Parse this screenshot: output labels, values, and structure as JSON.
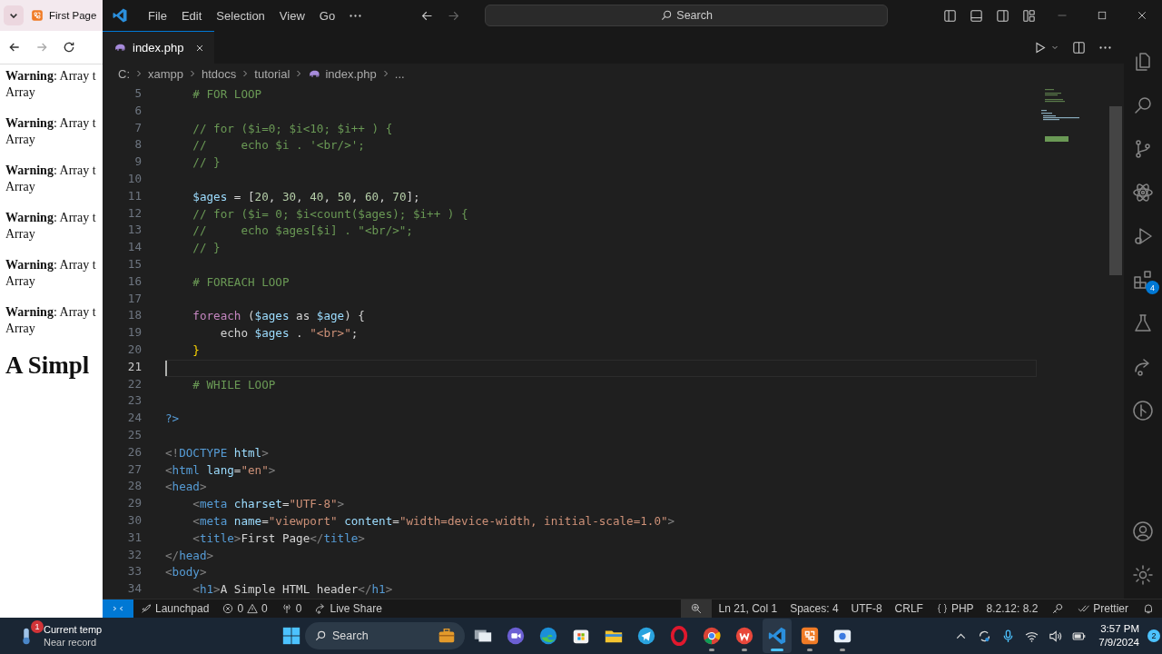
{
  "browser": {
    "tab": {
      "title": "First Page",
      "selected": true
    },
    "back": {
      "disabled": false
    },
    "forward": {
      "disabled": true
    },
    "warnings": [
      {
        "message": "**Warning**: Array t",
        "value": "Array"
      },
      {
        "message": "**Warning**: Array t",
        "value": "Array"
      },
      {
        "message": "**Warning**: Array t",
        "value": "Array"
      },
      {
        "message": "**Warning**: Array t",
        "value": "Array"
      },
      {
        "message": "**Warning**: Array t",
        "value": "Array"
      },
      {
        "message": "**Warning**: Array t",
        "value": "Array"
      }
    ],
    "heading": "A Simpl"
  },
  "title_bar": {
    "menus": [
      "File",
      "Edit",
      "Selection",
      "View",
      "Go"
    ],
    "back": {
      "disabled": false
    },
    "forward": {
      "disabled": true
    },
    "command_center": "Search"
  },
  "tabs": [
    {
      "label": "index.php",
      "selected": true
    }
  ],
  "breadcrumb": [
    {
      "text": "C:",
      "kind": "folder"
    },
    {
      "text": "xampp",
      "kind": "folder"
    },
    {
      "text": "htdocs",
      "kind": "folder"
    },
    {
      "text": "tutorial",
      "kind": "folder"
    },
    {
      "text": "index.php",
      "kind": "file"
    },
    {
      "text": "...",
      "kind": "symbol"
    }
  ],
  "editor": {
    "lines": [
      {
        "number": "5",
        "current": false,
        "tokens": [
          {
            "kind": "comment",
            "text": "    # FOR LOOP"
          }
        ]
      },
      {
        "number": "6",
        "current": false
      },
      {
        "number": "7",
        "current": false,
        "tokens": [
          {
            "kind": "comment",
            "text": "    // for ($i=0; $i<10; $i++ ) {"
          }
        ]
      },
      {
        "number": "8",
        "current": false,
        "tokens": [
          {
            "kind": "comment",
            "text": "    //     echo $i . '<br/>';"
          }
        ]
      },
      {
        "number": "9",
        "current": false,
        "tokens": [
          {
            "kind": "comment",
            "text": "    // }"
          }
        ]
      },
      {
        "number": "10",
        "current": false
      },
      {
        "number": "11",
        "current": false,
        "tokens": [
          {
            "kind": "variable",
            "text": "    $ages"
          },
          {
            "kind": "plain",
            "text": " = ["
          },
          {
            "kind": "number",
            "text": "20"
          },
          {
            "kind": "plain",
            "text": ", "
          },
          {
            "kind": "number",
            "text": "30"
          },
          {
            "kind": "plain",
            "text": ", "
          },
          {
            "kind": "number",
            "text": "40"
          },
          {
            "kind": "plain",
            "text": ", "
          },
          {
            "kind": "number",
            "text": "50"
          },
          {
            "kind": "plain",
            "text": ", "
          },
          {
            "kind": "number",
            "text": "60"
          },
          {
            "kind": "plain",
            "text": ", "
          },
          {
            "kind": "number",
            "text": "70"
          },
          {
            "kind": "plain",
            "text": "];"
          }
        ]
      },
      {
        "number": "12",
        "current": false,
        "tokens": [
          {
            "kind": "comment",
            "text": "    // for ($i= 0; $i<count($ages); $i++ ) {"
          }
        ]
      },
      {
        "number": "13",
        "current": false,
        "tokens": [
          {
            "kind": "comment",
            "text": "    //     echo $ages[$i] . \"<br/>\";"
          }
        ]
      },
      {
        "number": "14",
        "current": false,
        "tokens": [
          {
            "kind": "comment",
            "text": "    // }"
          }
        ]
      },
      {
        "number": "15",
        "current": false
      },
      {
        "number": "16",
        "current": false,
        "tokens": [
          {
            "kind": "comment",
            "text": "    # FOREACH LOOP"
          }
        ]
      },
      {
        "number": "17",
        "current": false
      },
      {
        "number": "18",
        "current": false,
        "tokens": [
          {
            "kind": "keyword",
            "text": "    foreach"
          },
          {
            "kind": "plain",
            "text": " ("
          },
          {
            "kind": "variable",
            "text": "$ages"
          },
          {
            "kind": "plain",
            "text": " as "
          },
          {
            "kind": "variable",
            "text": "$age"
          },
          {
            "kind": "plain",
            "text": ") {"
          }
        ]
      },
      {
        "number": "19",
        "current": false,
        "tokens": [
          {
            "kind": "plain",
            "text": "        echo "
          },
          {
            "kind": "variable",
            "text": "$ages"
          },
          {
            "kind": "plain",
            "text": " . "
          },
          {
            "kind": "string",
            "text": "\"<br>\""
          },
          {
            "kind": "plain",
            "text": ";"
          }
        ]
      },
      {
        "number": "20",
        "current": false,
        "tokens": [
          {
            "kind": "brace",
            "text": "    }"
          }
        ]
      },
      {
        "number": "21",
        "current": true
      },
      {
        "number": "22",
        "current": false,
        "tokens": [
          {
            "kind": "comment",
            "text": "    # WHILE LOOP"
          }
        ]
      },
      {
        "number": "23",
        "current": false
      },
      {
        "number": "24",
        "current": false,
        "tokens": [
          {
            "kind": "tag",
            "text": "?>"
          }
        ]
      },
      {
        "number": "25",
        "current": false
      },
      {
        "number": "26",
        "current": false,
        "tokens": [
          {
            "kind": "bracket",
            "text": "<!"
          },
          {
            "kind": "tag",
            "text": "DOCTYPE"
          },
          {
            "kind": "attr",
            "text": " html"
          },
          {
            "kind": "bracket",
            "text": ">"
          }
        ]
      },
      {
        "number": "27",
        "current": false,
        "tokens": [
          {
            "kind": "bracket",
            "text": "<"
          },
          {
            "kind": "tag",
            "text": "html"
          },
          {
            "kind": "attr",
            "text": " lang"
          },
          {
            "kind": "plain",
            "text": "="
          },
          {
            "kind": "string",
            "text": "\"en\""
          },
          {
            "kind": "bracket",
            "text": ">"
          }
        ]
      },
      {
        "number": "28",
        "current": false,
        "tokens": [
          {
            "kind": "bracket",
            "text": "<"
          },
          {
            "kind": "tag",
            "text": "head"
          },
          {
            "kind": "bracket",
            "text": ">"
          }
        ]
      },
      {
        "number": "29",
        "current": false,
        "tokens": [
          {
            "kind": "bracket",
            "text": "    <"
          },
          {
            "kind": "tag",
            "text": "meta"
          },
          {
            "kind": "attr",
            "text": " charset"
          },
          {
            "kind": "plain",
            "text": "="
          },
          {
            "kind": "string",
            "text": "\"UTF-8\""
          },
          {
            "kind": "bracket",
            "text": ">"
          }
        ]
      },
      {
        "number": "30",
        "current": false,
        "tokens": [
          {
            "kind": "bracket",
            "text": "    <"
          },
          {
            "kind": "tag",
            "text": "meta"
          },
          {
            "kind": "attr",
            "text": " name"
          },
          {
            "kind": "plain",
            "text": "="
          },
          {
            "kind": "string",
            "text": "\"viewport\""
          },
          {
            "kind": "attr",
            "text": " content"
          },
          {
            "kind": "plain",
            "text": "="
          },
          {
            "kind": "string",
            "text": "\"width=device-width, initial-scale=1.0\""
          },
          {
            "kind": "bracket",
            "text": ">"
          }
        ]
      },
      {
        "number": "31",
        "current": false,
        "tokens": [
          {
            "kind": "bracket",
            "text": "    <"
          },
          {
            "kind": "tag",
            "text": "title"
          },
          {
            "kind": "bracket",
            "text": ">"
          },
          {
            "kind": "plain",
            "text": "First Page"
          },
          {
            "kind": "bracket",
            "text": "</"
          },
          {
            "kind": "tag",
            "text": "title"
          },
          {
            "kind": "bracket",
            "text": ">"
          }
        ]
      },
      {
        "number": "32",
        "current": false,
        "tokens": [
          {
            "kind": "bracket",
            "text": "</"
          },
          {
            "kind": "tag",
            "text": "head"
          },
          {
            "kind": "bracket",
            "text": ">"
          }
        ]
      },
      {
        "number": "33",
        "current": false,
        "tokens": [
          {
            "kind": "bracket",
            "text": "<"
          },
          {
            "kind": "tag",
            "text": "body"
          },
          {
            "kind": "bracket",
            "text": ">"
          }
        ]
      },
      {
        "number": "34",
        "current": false,
        "tokens": [
          {
            "kind": "bracket",
            "text": "    <"
          },
          {
            "kind": "tag",
            "text": "h1"
          },
          {
            "kind": "bracket",
            "text": ">"
          },
          {
            "kind": "plain",
            "text": "A Simple HTML header"
          },
          {
            "kind": "bracket",
            "text": "</"
          },
          {
            "kind": "tag",
            "text": "h1"
          },
          {
            "kind": "bracket",
            "text": ">"
          }
        ]
      }
    ]
  },
  "activity_bar": [
    {
      "kind": "explorer"
    },
    {
      "kind": "search"
    },
    {
      "kind": "source-control"
    },
    {
      "kind": "react"
    },
    {
      "kind": "run-debug"
    },
    {
      "kind": "extensions",
      "badge": "4"
    },
    {
      "kind": "testing"
    },
    {
      "kind": "live-share"
    },
    {
      "kind": "git-graph"
    },
    {
      "kind": "spacer"
    },
    {
      "kind": "account"
    },
    {
      "kind": "manage"
    }
  ],
  "status_bar": {
    "left": [
      {
        "kind": "remote"
      },
      {
        "kind": "launchpad",
        "text": "Launchpad"
      },
      {
        "kind": "problems",
        "errors": "0",
        "warnings": "0"
      },
      {
        "kind": "ports",
        "text": "0"
      },
      {
        "kind": "live-share",
        "text": "Live Share"
      }
    ],
    "right": [
      {
        "kind": "zoom"
      },
      {
        "kind": "text",
        "text": "Ln 21, Col 1"
      },
      {
        "kind": "text",
        "text": "Spaces: 4"
      },
      {
        "kind": "text",
        "text": "UTF-8"
      },
      {
        "kind": "text",
        "text": "CRLF"
      },
      {
        "kind": "language",
        "text": "PHP"
      },
      {
        "kind": "text",
        "text": "8.2.12: 8.2"
      },
      {
        "kind": "key"
      },
      {
        "kind": "prettier",
        "text": "Prettier"
      },
      {
        "kind": "bell"
      }
    ]
  },
  "taskbar": {
    "weather": {
      "badge": "1",
      "title": "Current temp",
      "subtitle": "Near record"
    },
    "search": {
      "placeholder": "Search"
    },
    "apps": [
      {
        "kind": "taskview",
        "running": false,
        "active": false
      },
      {
        "kind": "meet",
        "running": false,
        "active": false
      },
      {
        "kind": "edge",
        "running": false,
        "active": false
      },
      {
        "kind": "store",
        "running": false,
        "active": false
      },
      {
        "kind": "files",
        "running": false,
        "active": false
      },
      {
        "kind": "telegram",
        "running": false,
        "active": false
      },
      {
        "kind": "opera",
        "running": false,
        "active": false
      },
      {
        "kind": "chrome",
        "running": true,
        "active": false
      },
      {
        "kind": "wps",
        "running": true,
        "active": false
      },
      {
        "kind": "vscode",
        "running": true,
        "active": true
      },
      {
        "kind": "xampp",
        "running": true,
        "active": false
      },
      {
        "kind": "camera",
        "running": true,
        "active": false
      }
    ],
    "time": "3:57 PM",
    "date": "7/9/2024",
    "notifications": "2"
  }
}
